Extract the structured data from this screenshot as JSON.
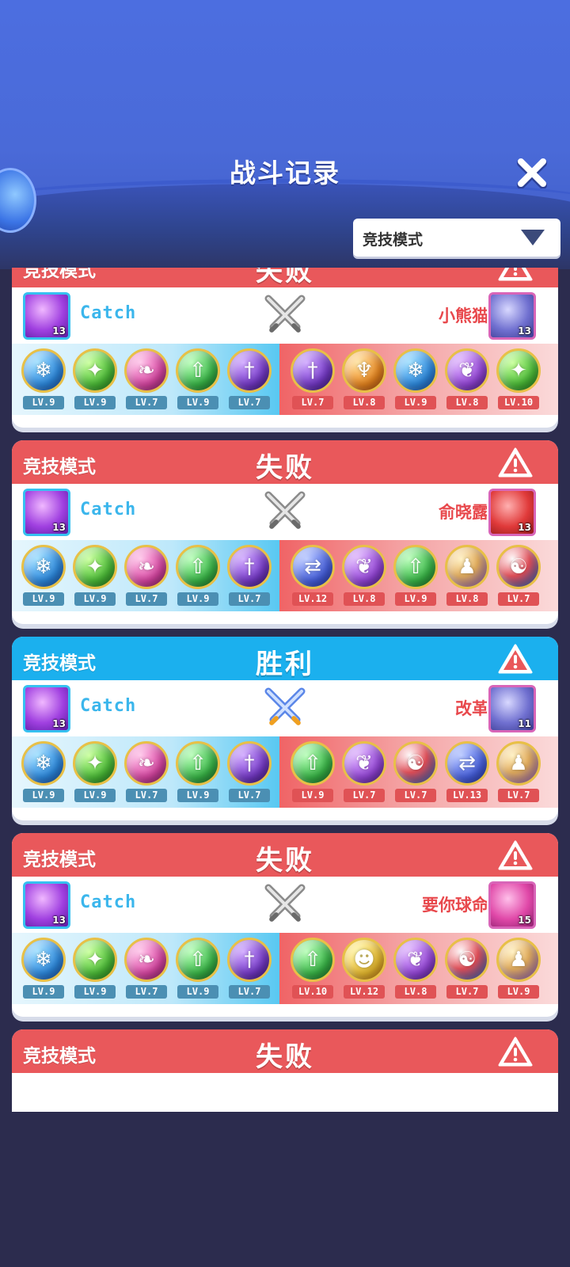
{
  "header": {
    "title": "战斗记录",
    "close_icon": "close-icon"
  },
  "filter": {
    "selected": "竞技模式"
  },
  "colors": {
    "lose": "#e9585b",
    "win": "#1bb0ee",
    "accent_blue": "#3bb6ec",
    "accent_red": "#e8484c"
  },
  "records": [
    {
      "mode": "竞技模式",
      "result": "失败",
      "outcome": "lose",
      "player": {
        "name": "Catch",
        "level": "13"
      },
      "opponent": {
        "name": "小熊猫",
        "level": "13"
      },
      "my_team": [
        {
          "icon": "snowflake-orb",
          "lv": "LV.9"
        },
        {
          "icon": "star-orb",
          "lv": "LV.9"
        },
        {
          "icon": "feather-orb",
          "lv": "LV.7"
        },
        {
          "icon": "arrow-orb",
          "lv": "LV.9"
        },
        {
          "icon": "sword-orb",
          "lv": "LV.7"
        }
      ],
      "enemy_team": [
        {
          "icon": "sword-orb",
          "lv": "LV.7"
        },
        {
          "icon": "phoenix-orb",
          "lv": "LV.8"
        },
        {
          "icon": "snowflake-orb",
          "lv": "LV.9"
        },
        {
          "icon": "leaf-orb",
          "lv": "LV.8"
        },
        {
          "icon": "star-orb",
          "lv": "LV.10"
        }
      ]
    },
    {
      "mode": "竞技模式",
      "result": "失败",
      "outcome": "lose",
      "player": {
        "name": "Catch",
        "level": "13"
      },
      "opponent": {
        "name": "俞晓露",
        "level": "13"
      },
      "my_team": [
        {
          "icon": "snowflake-orb",
          "lv": "LV.9"
        },
        {
          "icon": "star-orb",
          "lv": "LV.9"
        },
        {
          "icon": "feather-orb",
          "lv": "LV.7"
        },
        {
          "icon": "arrow-orb",
          "lv": "LV.9"
        },
        {
          "icon": "sword-orb",
          "lv": "LV.7"
        }
      ],
      "enemy_team": [
        {
          "icon": "swap-orb",
          "lv": "LV.12"
        },
        {
          "icon": "leaf-orb",
          "lv": "LV.8"
        },
        {
          "icon": "arrow-orb",
          "lv": "LV.9"
        },
        {
          "icon": "crowd-orb",
          "lv": "LV.8"
        },
        {
          "icon": "swirl-orb",
          "lv": "LV.7"
        }
      ]
    },
    {
      "mode": "竞技模式",
      "result": "胜利",
      "outcome": "win",
      "player": {
        "name": "Catch",
        "level": "13"
      },
      "opponent": {
        "name": "改革",
        "level": "11"
      },
      "my_team": [
        {
          "icon": "snowflake-orb",
          "lv": "LV.9"
        },
        {
          "icon": "star-orb",
          "lv": "LV.9"
        },
        {
          "icon": "feather-orb",
          "lv": "LV.7"
        },
        {
          "icon": "arrow-orb",
          "lv": "LV.9"
        },
        {
          "icon": "sword-orb",
          "lv": "LV.7"
        }
      ],
      "enemy_team": [
        {
          "icon": "arrow-orb",
          "lv": "LV.9"
        },
        {
          "icon": "leaf-orb",
          "lv": "LV.7"
        },
        {
          "icon": "swirl-orb",
          "lv": "LV.7"
        },
        {
          "icon": "swap-orb",
          "lv": "LV.13"
        },
        {
          "icon": "crowd-orb",
          "lv": "LV.7"
        }
      ]
    },
    {
      "mode": "竞技模式",
      "result": "失败",
      "outcome": "lose",
      "player": {
        "name": "Catch",
        "level": "13"
      },
      "opponent": {
        "name": "要你球命",
        "level": "15"
      },
      "my_team": [
        {
          "icon": "snowflake-orb",
          "lv": "LV.9"
        },
        {
          "icon": "star-orb",
          "lv": "LV.9"
        },
        {
          "icon": "feather-orb",
          "lv": "LV.7"
        },
        {
          "icon": "arrow-orb",
          "lv": "LV.9"
        },
        {
          "icon": "sword-orb",
          "lv": "LV.7"
        }
      ],
      "enemy_team": [
        {
          "icon": "arrow-orb",
          "lv": "LV.10"
        },
        {
          "icon": "pumpkin-orb",
          "lv": "LV.12"
        },
        {
          "icon": "leaf-orb",
          "lv": "LV.8"
        },
        {
          "icon": "swirl-orb",
          "lv": "LV.7"
        },
        {
          "icon": "crowd-orb",
          "lv": "LV.9"
        }
      ]
    },
    {
      "mode": "竞技模式",
      "result": "失败",
      "outcome": "lose",
      "player": {
        "name": "",
        "level": ""
      },
      "opponent": {
        "name": "",
        "level": ""
      },
      "my_team": [],
      "enemy_team": []
    }
  ]
}
